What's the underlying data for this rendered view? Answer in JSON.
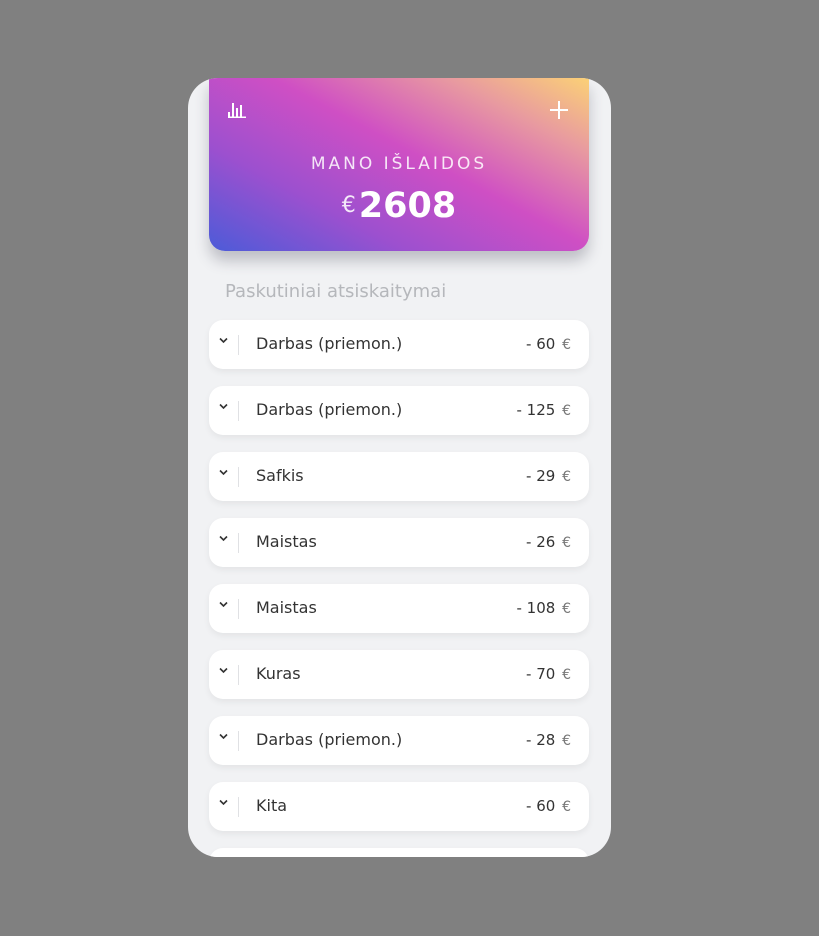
{
  "header": {
    "title": "MANO IŠLAIDOS",
    "currency": "€",
    "total": "2608"
  },
  "icons": {
    "stats": "bar-chart-icon",
    "add": "plus-icon",
    "expand": "chevron-down-icon"
  },
  "section_title": "Paskutiniai atsiskaitymai",
  "transactions": [
    {
      "name": "Darbas (priemon.)",
      "amount": "- 60",
      "currency": "€"
    },
    {
      "name": "Darbas (priemon.)",
      "amount": "- 125",
      "currency": "€"
    },
    {
      "name": "Safkis",
      "amount": "- 29",
      "currency": "€"
    },
    {
      "name": "Maistas",
      "amount": "- 26",
      "currency": "€"
    },
    {
      "name": "Maistas",
      "amount": "- 108",
      "currency": "€"
    },
    {
      "name": "Kuras",
      "amount": "- 70",
      "currency": "€"
    },
    {
      "name": "Darbas (priemon.)",
      "amount": "- 28",
      "currency": "€"
    },
    {
      "name": "Kita",
      "amount": "- 60",
      "currency": "€"
    },
    {
      "name": "",
      "amount": "",
      "currency": ""
    }
  ]
}
